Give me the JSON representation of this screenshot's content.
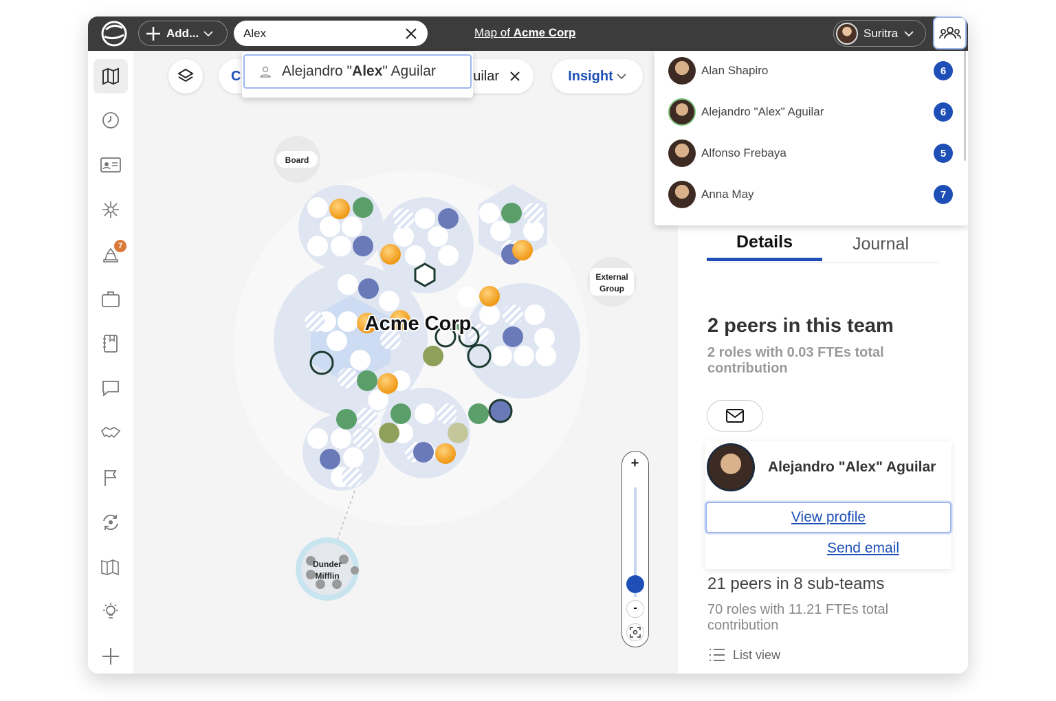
{
  "topbar": {
    "add_label": "Add...",
    "search_value": "Alex",
    "map_title_prefix": "Map of",
    "map_title_org": "Acme Corp",
    "user_name": "Suritra"
  },
  "sidebar": {
    "items": [
      {
        "icon": "map-icon",
        "active": true
      },
      {
        "icon": "clock-icon"
      },
      {
        "icon": "id-card-icon"
      },
      {
        "icon": "network-icon"
      },
      {
        "icon": "tasks-icon",
        "badge": "7"
      },
      {
        "icon": "briefcase-icon"
      },
      {
        "icon": "notebook-icon"
      },
      {
        "icon": "chat-icon"
      },
      {
        "icon": "handshake-icon"
      },
      {
        "icon": "flag-icon"
      },
      {
        "icon": "sync-icon"
      },
      {
        "icon": "book-icon"
      },
      {
        "icon": "lightbulb-icon"
      },
      {
        "icon": "plus-icon"
      }
    ]
  },
  "toolbar": {
    "filter_prefix": "C",
    "filter_suffix": "uilar",
    "insight_label": "Insight"
  },
  "suggestion": {
    "pre": "Alejandro \"",
    "bold": "Alex",
    "post": "\" Aguilar"
  },
  "map": {
    "center_label": "Acme Corp",
    "board_label": "Board",
    "external_line1": "External",
    "external_line2": "Group",
    "dunder_line1": "Dunder",
    "dunder_line2": "Mifflin"
  },
  "zoom": {
    "plus": "+",
    "minus": "-"
  },
  "people": [
    {
      "name": "Alan Shapiro",
      "count": "6"
    },
    {
      "name": "Alejandro \"Alex\" Aguilar",
      "count": "6",
      "selected": true
    },
    {
      "name": "Alfonso Frebaya",
      "count": "5"
    },
    {
      "name": "Anna May",
      "count": "7"
    }
  ],
  "details": {
    "tab_details": "Details",
    "tab_journal": "Journal",
    "peers_title": "2 peers in this team",
    "peers_sub": "2 roles with 0.03 FTEs total contribution",
    "person_name": "Alejandro \"Alex\" Aguilar",
    "view_profile": "View profile",
    "send_email": "Send email",
    "sub_title": "21 peers in 8 sub-teams",
    "sub_sub": "70 roles with 11.21 FTEs total contribution",
    "list_view": "List view"
  },
  "colors": {
    "topbar": "#3c3c3c",
    "accent": "#1d4fb6",
    "green": "#5a9e6a",
    "orange": "#f0a020",
    "purple": "#6a7ab8"
  }
}
